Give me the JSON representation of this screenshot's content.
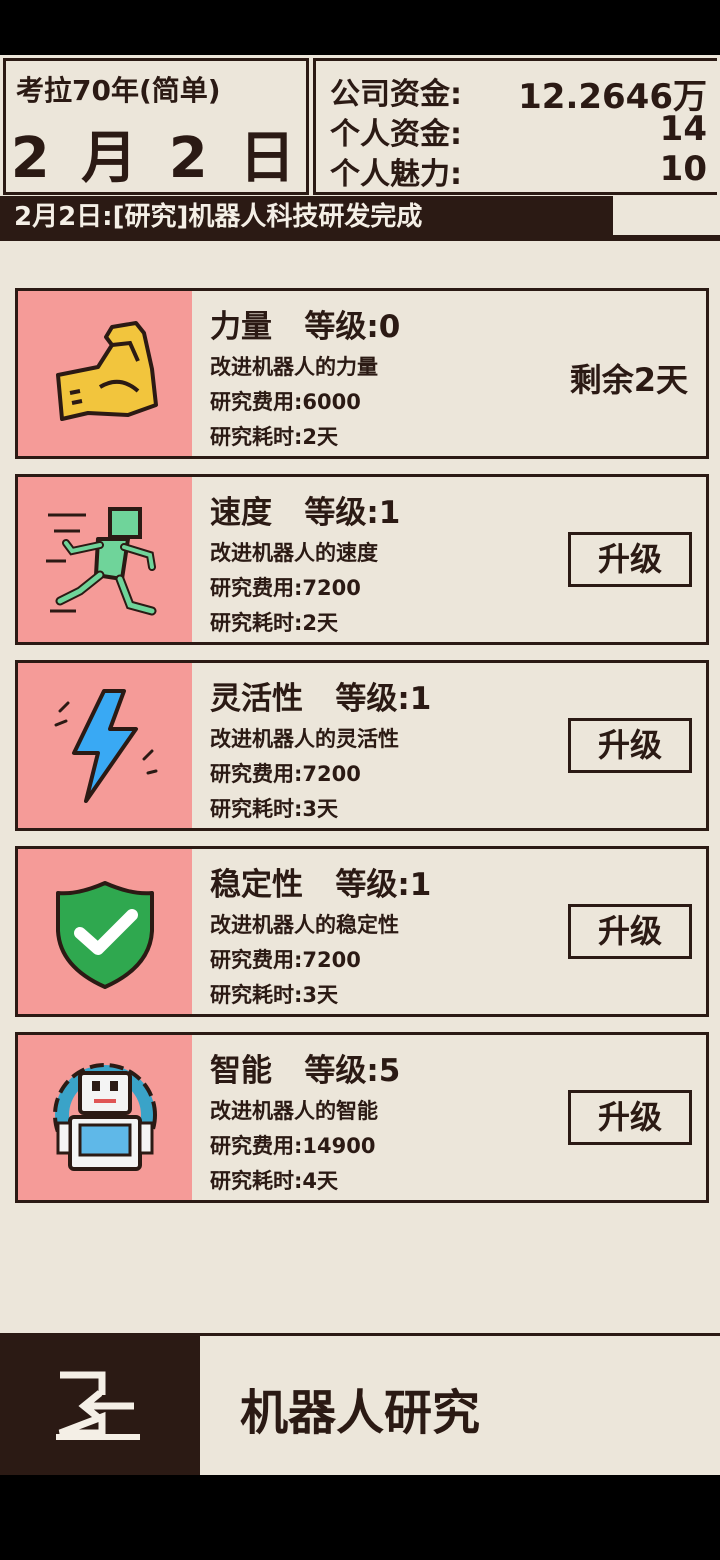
{
  "header": {
    "era": "考拉70年(简单)",
    "date": "2 月 2 日",
    "stats": [
      {
        "label": "公司资金:",
        "value": "12.2646万"
      },
      {
        "label": "个人资金:",
        "value": "14"
      },
      {
        "label": "个人魅力:",
        "value": "10"
      }
    ]
  },
  "news": "2月2日:[研究]机器人科技研发完成",
  "research": [
    {
      "name": "力量",
      "level": "等级:0",
      "desc": "改进机器人的力量",
      "cost": "研究费用:6000",
      "time": "研究耗时:2天",
      "status": "剩余2天",
      "icon": "flexed-arm-icon"
    },
    {
      "name": "速度",
      "level": "等级:1",
      "desc": "改进机器人的速度",
      "cost": "研究费用:7200",
      "time": "研究耗时:2天",
      "action": "升级",
      "icon": "running-robot-icon"
    },
    {
      "name": "灵活性",
      "level": "等级:1",
      "desc": "改进机器人的灵活性",
      "cost": "研究费用:7200",
      "time": "研究耗时:3天",
      "action": "升级",
      "icon": "lightning-icon"
    },
    {
      "name": "稳定性",
      "level": "等级:1",
      "desc": "改进机器人的稳定性",
      "cost": "研究费用:7200",
      "time": "研究耗时:3天",
      "action": "升级",
      "icon": "shield-check-icon"
    },
    {
      "name": "智能",
      "level": "等级:5",
      "desc": "改进机器人的智能",
      "cost": "研究费用:14900",
      "time": "研究耗时:4天",
      "action": "升级",
      "icon": "robot-gear-icon"
    }
  ],
  "footer": {
    "title": "机器人研究",
    "exit_icon": "exit-door-icon"
  },
  "colors": {
    "dark": "#2b1a14",
    "background": "#ece6da",
    "icon_panel": "#f59b98"
  }
}
